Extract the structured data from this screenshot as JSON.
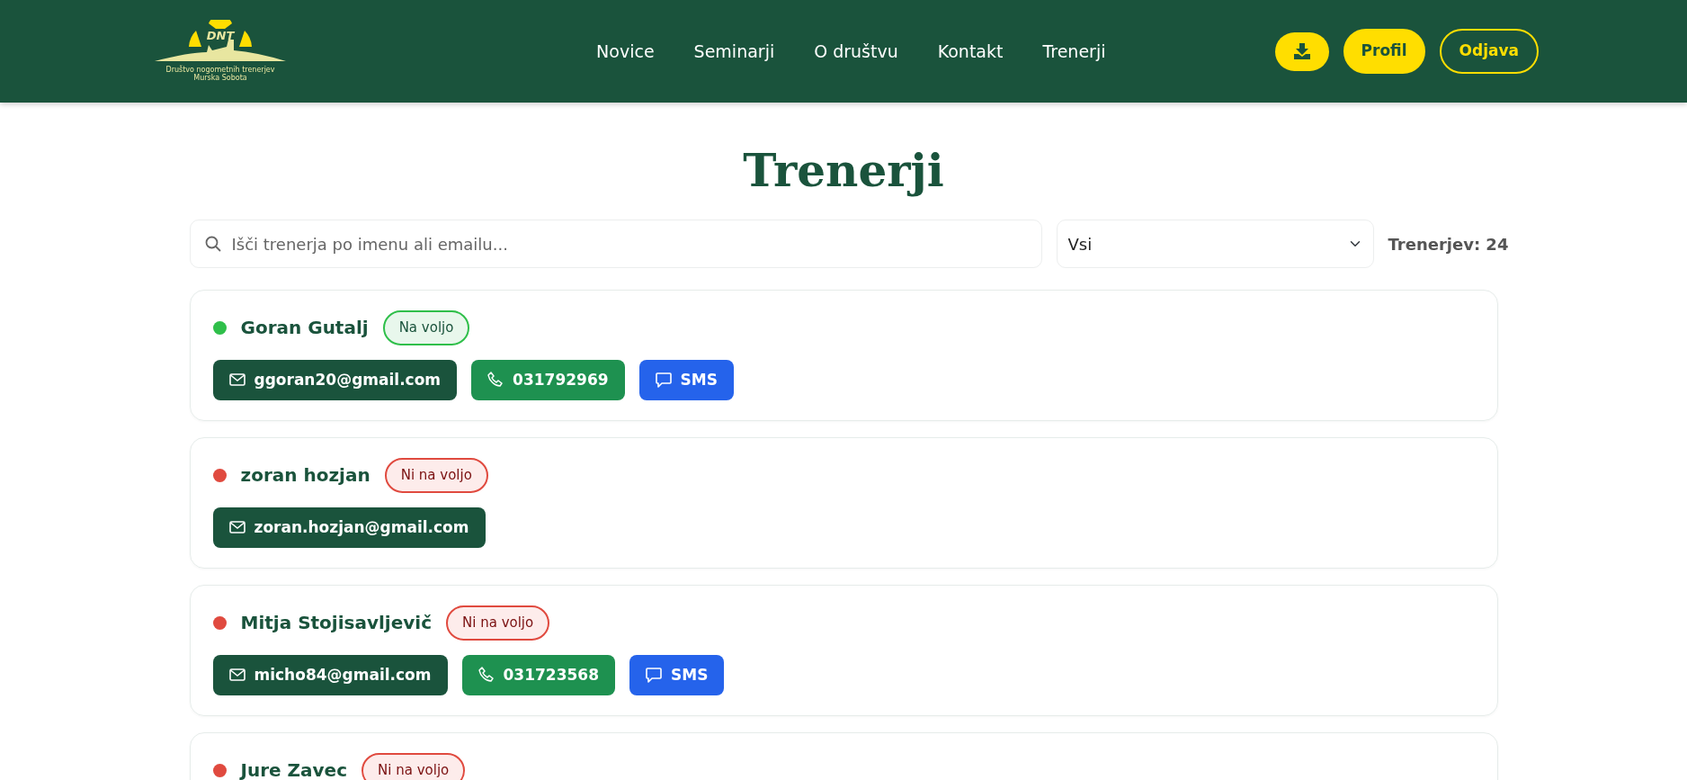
{
  "logo": {
    "mark": "DNT",
    "line_1": "Društvo nogometnih trenerjev",
    "line_2": "Murska Sobota"
  },
  "nav": [
    {
      "label": "Novice"
    },
    {
      "label": "Seminarji"
    },
    {
      "label": "O društvu"
    },
    {
      "label": "Kontakt"
    },
    {
      "label": "Trenerji"
    }
  ],
  "actions": [
    {
      "kind": "download"
    },
    {
      "kind": "solid",
      "label": "Profil"
    },
    {
      "kind": "outline",
      "label": "Odjava"
    }
  ],
  "title": "Trenerji",
  "search": {
    "placeholder": "Išči trenerja po imenu ali emailu..."
  },
  "filter": {
    "value": "Vsi"
  },
  "count": "Trenerjev: 24",
  "coaches": [
    {
      "name": "Goran Gutalj",
      "available": true,
      "badge": "Na voljo",
      "contacts": [
        {
          "kind": "email",
          "label": "ggoran20@gmail.com"
        },
        {
          "kind": "phone",
          "label": "031792969"
        },
        {
          "kind": "sms",
          "label": "SMS"
        }
      ]
    },
    {
      "name": "zoran hozjan",
      "available": false,
      "badge": "Ni na voljo",
      "contacts": [
        {
          "kind": "email",
          "label": "zoran.hozjan@gmail.com"
        }
      ]
    },
    {
      "name": "Mitja Stojisavljevič",
      "available": false,
      "badge": "Ni na voljo",
      "contacts": [
        {
          "kind": "email",
          "label": "micho84@gmail.com"
        },
        {
          "kind": "phone",
          "label": "031723568"
        },
        {
          "kind": "sms",
          "label": "SMS"
        }
      ]
    },
    {
      "name": "Jure Zavec",
      "available": false,
      "badge": "Ni na voljo"
    }
  ]
}
